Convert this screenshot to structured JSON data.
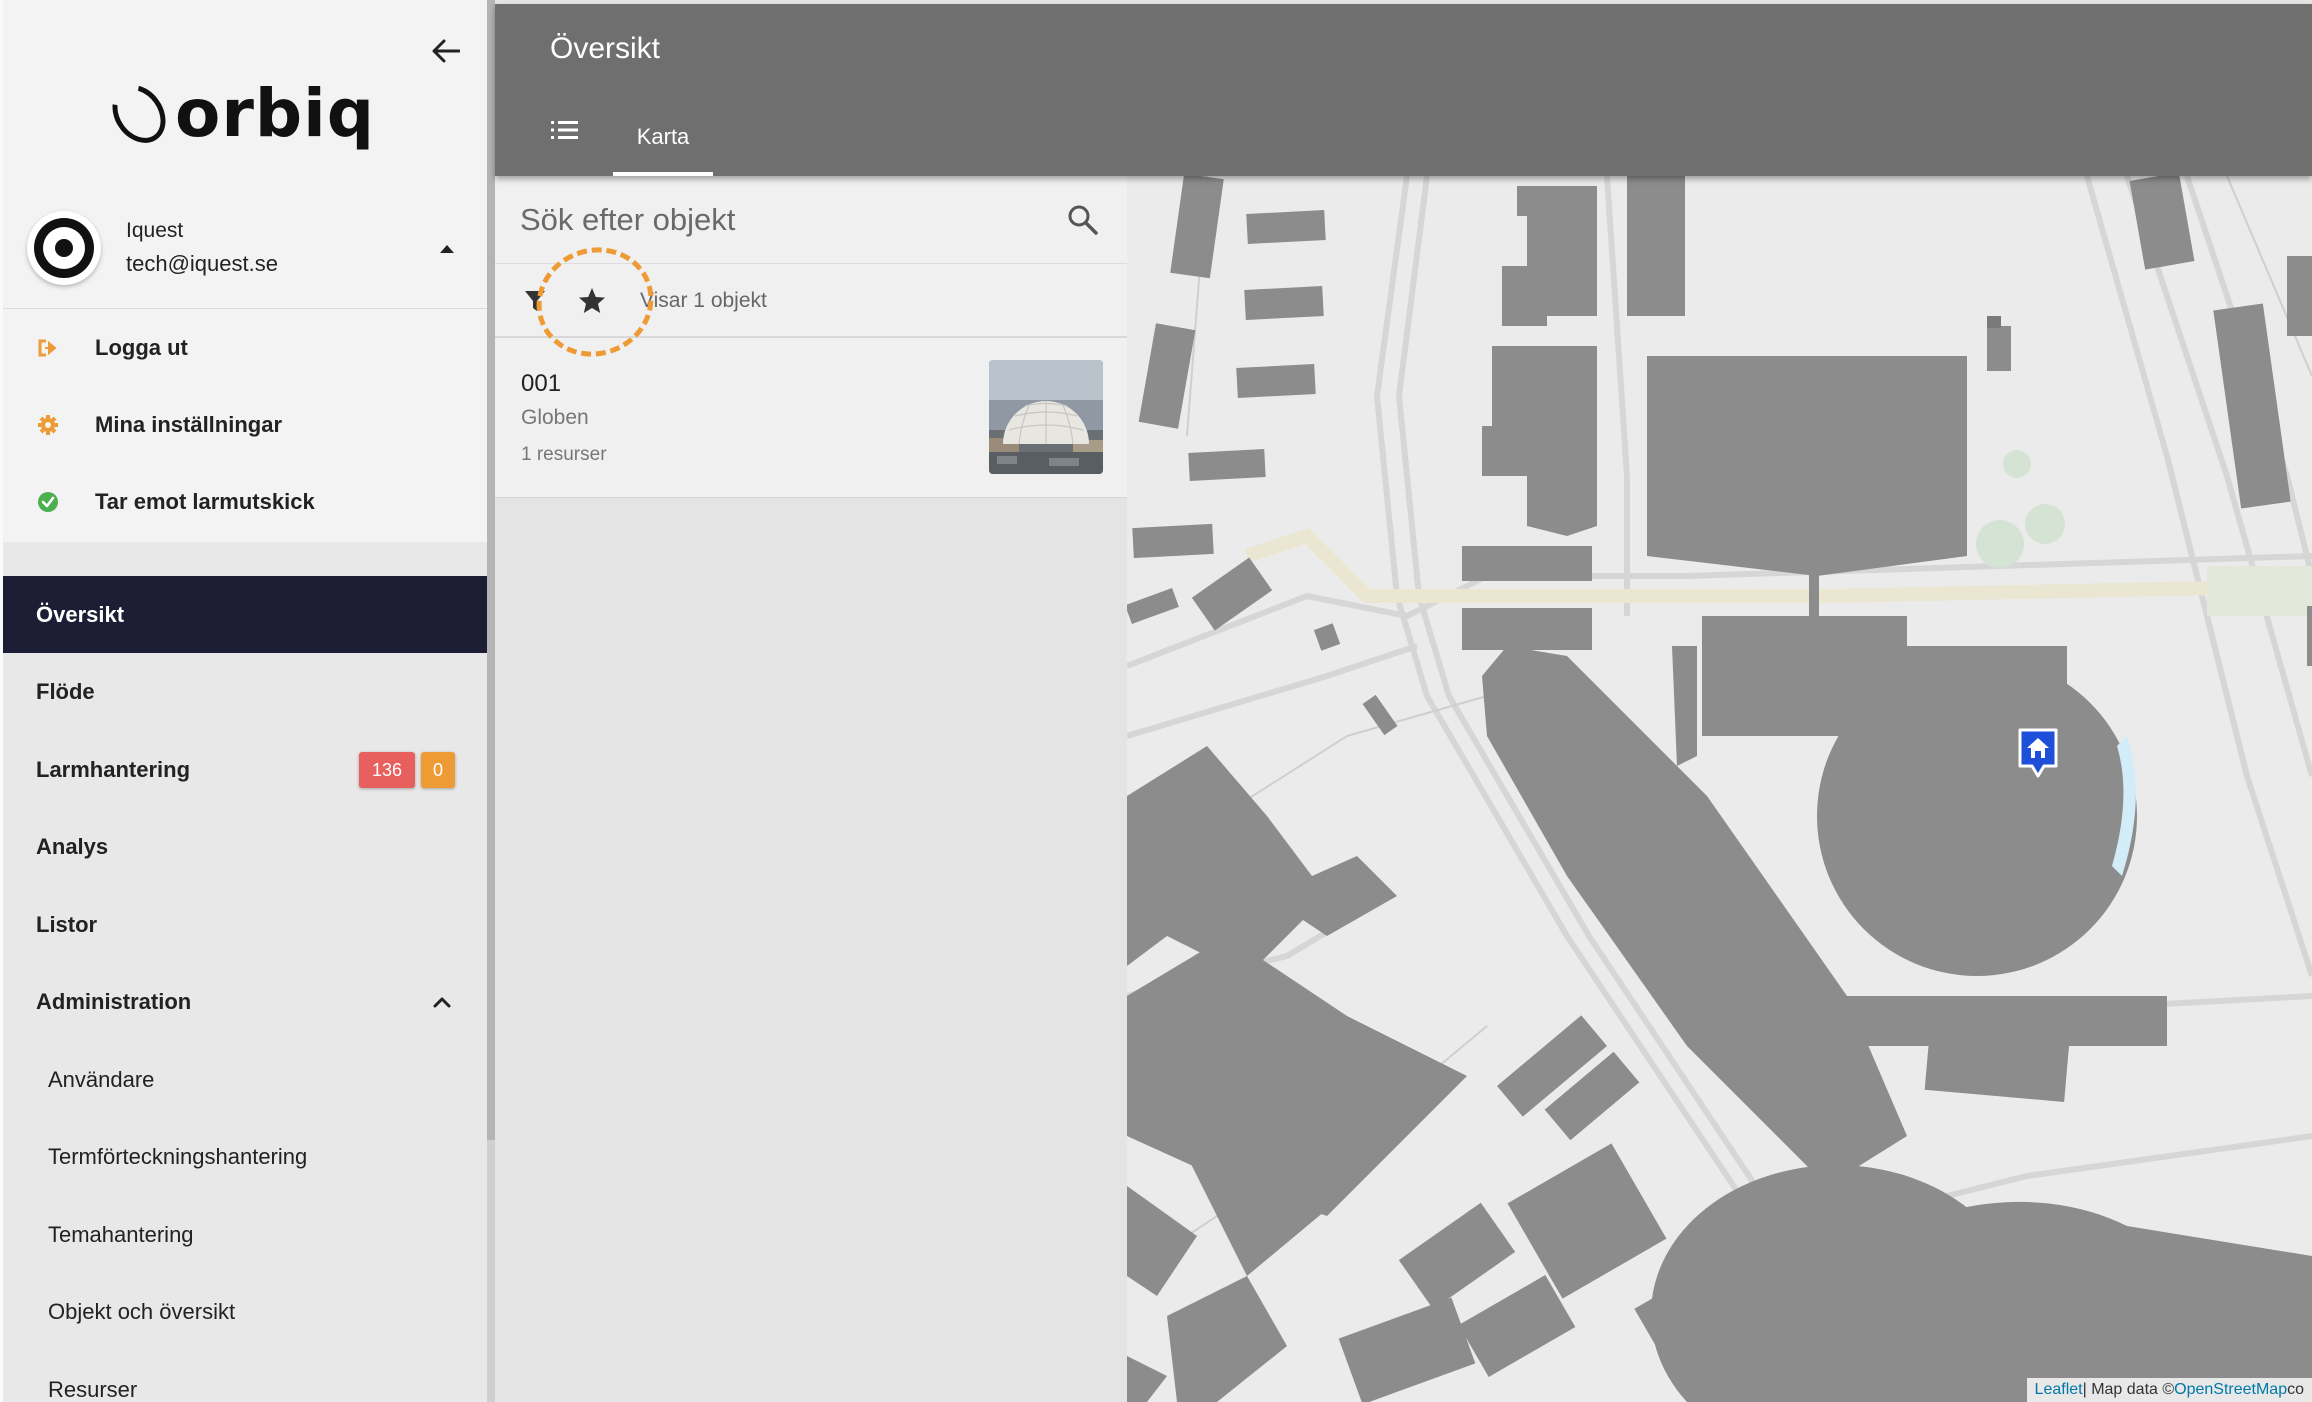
{
  "brand": {
    "name": "orbiq"
  },
  "user": {
    "name": "Iquest",
    "email": "tech@iquest.se"
  },
  "user_menu": [
    {
      "label": "Logga ut",
      "icon": "sign-out-icon",
      "color": "#ee9b35"
    },
    {
      "label": "Mina inställningar",
      "icon": "gear-icon",
      "color": "#ee9b35"
    },
    {
      "label": "Tar emot larmutskick",
      "icon": "check-circle-icon",
      "color": "#4caf50"
    }
  ],
  "nav": {
    "items": [
      {
        "label": "Översikt",
        "active": true
      },
      {
        "label": "Flöde"
      },
      {
        "label": "Larmhantering",
        "badges": [
          "136",
          "0"
        ]
      },
      {
        "label": "Analys"
      },
      {
        "label": "Listor"
      },
      {
        "label": "Administration",
        "expanded": true
      }
    ],
    "sub_items": [
      {
        "label": "Användare"
      },
      {
        "label": "Termförteckningshantering"
      },
      {
        "label": "Temahantering"
      },
      {
        "label": "Objekt och översikt"
      },
      {
        "label": "Resurser"
      }
    ]
  },
  "header": {
    "title": "Översikt",
    "tabs": [
      {
        "label": "Karta",
        "active": true
      }
    ]
  },
  "panel": {
    "search_placeholder": "Sök efter objekt",
    "count_text": "Visar 1 objekt",
    "objects": [
      {
        "id": "001",
        "name": "Globen",
        "resources": "1 resurser"
      }
    ]
  },
  "map": {
    "attribution_leaflet": "Leaflet",
    "attribution_sep": " | Map data © ",
    "attribution_osm": "OpenStreetMap",
    "attribution_tail": " co"
  },
  "colors": {
    "accent": "#ee9b35",
    "nav_active": "#1d1d35",
    "header": "#6f6f6f",
    "badge_red": "#e8605e",
    "badge_orange": "#ee9b35",
    "marker": "#1e4fd8",
    "building": "#8c8c8c"
  }
}
